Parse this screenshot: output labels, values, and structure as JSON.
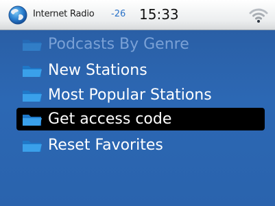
{
  "status_bar": {
    "app_title": "Internet Radio",
    "signal_strength": "-26",
    "time": "15:33"
  },
  "menu": {
    "items": [
      {
        "label": "Podcasts By Genre",
        "faded": true,
        "selected": false
      },
      {
        "label": "New Stations",
        "faded": false,
        "selected": false
      },
      {
        "label": "Most Popular Stations",
        "faded": false,
        "selected": false
      },
      {
        "label": "Get access code",
        "faded": false,
        "selected": true
      },
      {
        "label": "Reset Favorites",
        "faded": false,
        "selected": false
      }
    ]
  },
  "icons": {
    "app": "globe-icon",
    "connection": "wifi-icon",
    "menu_item": "folder-icon"
  },
  "colors": {
    "background": "#2b64ae",
    "selection": "#000000",
    "text": "#ffffff"
  }
}
